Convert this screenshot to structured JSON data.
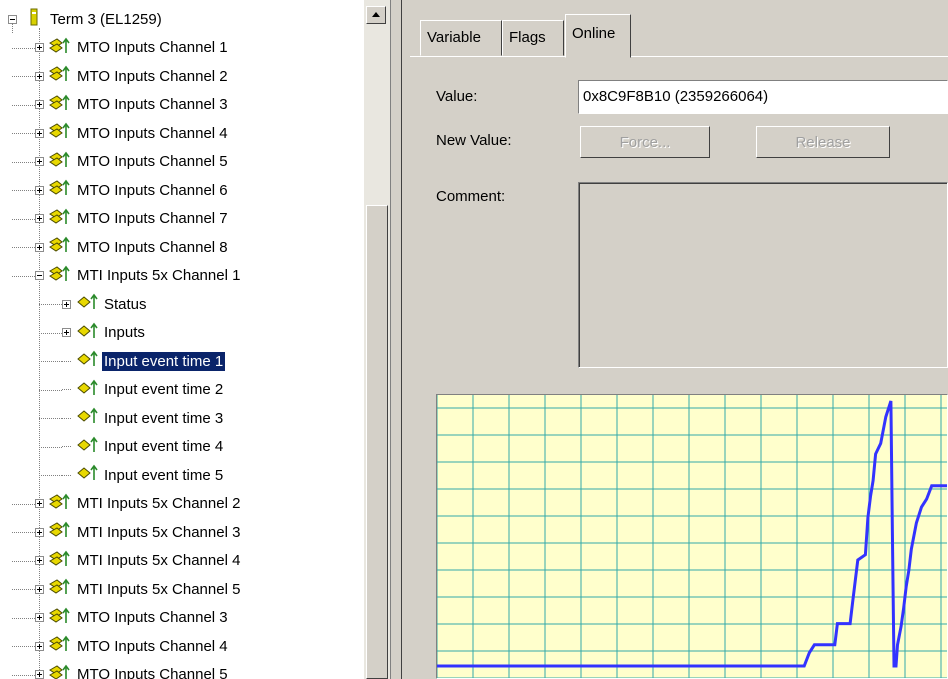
{
  "tree": {
    "root": {
      "label": "Term 3 (EL1259)",
      "icon": "terminal-icon"
    },
    "items": [
      {
        "label": "MTO Inputs Channel 1",
        "level": 1,
        "expander": "plus",
        "icon": "variable-group-icon"
      },
      {
        "label": "MTO Inputs Channel 2",
        "level": 1,
        "expander": "plus",
        "icon": "variable-group-icon"
      },
      {
        "label": "MTO Inputs Channel 3",
        "level": 1,
        "expander": "plus",
        "icon": "variable-group-icon"
      },
      {
        "label": "MTO Inputs Channel 4",
        "level": 1,
        "expander": "plus",
        "icon": "variable-group-icon"
      },
      {
        "label": "MTO Inputs Channel 5",
        "level": 1,
        "expander": "plus",
        "icon": "variable-group-icon"
      },
      {
        "label": "MTO Inputs Channel 6",
        "level": 1,
        "expander": "plus",
        "icon": "variable-group-icon"
      },
      {
        "label": "MTO Inputs Channel 7",
        "level": 1,
        "expander": "plus",
        "icon": "variable-group-icon"
      },
      {
        "label": "MTO Inputs Channel 8",
        "level": 1,
        "expander": "plus",
        "icon": "variable-group-icon"
      },
      {
        "label": "MTI Inputs 5x Channel 1",
        "level": 1,
        "expander": "minus",
        "icon": "variable-group-icon"
      },
      {
        "label": "Status",
        "level": 2,
        "expander": "plus",
        "icon": "input-variable-icon"
      },
      {
        "label": "Inputs",
        "level": 2,
        "expander": "plus",
        "icon": "input-variable-icon"
      },
      {
        "label": "Input event time 1",
        "level": 2,
        "expander": "none",
        "icon": "input-variable-icon",
        "selected": true
      },
      {
        "label": "Input event time 2",
        "level": 2,
        "expander": "none",
        "icon": "input-variable-icon"
      },
      {
        "label": "Input event time 3",
        "level": 2,
        "expander": "none",
        "icon": "input-variable-icon"
      },
      {
        "label": "Input event time 4",
        "level": 2,
        "expander": "none",
        "icon": "input-variable-icon"
      },
      {
        "label": "Input event time 5",
        "level": 2,
        "expander": "none",
        "icon": "input-variable-icon"
      },
      {
        "label": "MTI Inputs 5x Channel 2",
        "level": 1,
        "expander": "plus",
        "icon": "variable-group-icon"
      },
      {
        "label": "MTI Inputs 5x Channel 3",
        "level": 1,
        "expander": "plus",
        "icon": "variable-group-icon"
      },
      {
        "label": "MTI Inputs 5x Channel 4",
        "level": 1,
        "expander": "plus",
        "icon": "variable-group-icon"
      },
      {
        "label": "MTI Inputs 5x Channel 5",
        "level": 1,
        "expander": "plus",
        "icon": "variable-group-icon"
      },
      {
        "label": "MTO Inputs Channel 3",
        "level": 1,
        "expander": "plus",
        "icon": "variable-group-icon"
      },
      {
        "label": "MTO Inputs Channel 4",
        "level": 1,
        "expander": "plus",
        "icon": "variable-group-icon"
      },
      {
        "label": "MTO Inputs Channel 5",
        "level": 1,
        "expander": "plus",
        "icon": "variable-group-icon"
      }
    ]
  },
  "tabs": [
    {
      "label": "Variable",
      "active": false
    },
    {
      "label": "Flags",
      "active": false
    },
    {
      "label": "Online",
      "active": true
    }
  ],
  "online": {
    "value_label": "Value:",
    "value": "0x8C9F8B10 (2359266064)",
    "new_value_label": "New Value:",
    "force_button": "Force...",
    "release_button": "Release",
    "comment_label": "Comment:",
    "comment": ""
  },
  "colors": {
    "chart_background": "#ffffcc",
    "chart_grid": "#33aaaa",
    "chart_line": "#3333ff",
    "selection": "#0a246a",
    "panel": "#d4d0c8",
    "icon_yellow": "#e8d800",
    "icon_dark": "#4a4a00"
  },
  "chart_data": {
    "type": "line",
    "title": "",
    "xlabel": "",
    "ylabel": "",
    "grid": true,
    "xlim": [
      0,
      100
    ],
    "ylim": [
      0,
      100
    ],
    "series": [
      {
        "x": [
          0,
          72,
          73,
          74,
          78,
          78.5,
          81,
          81.5,
          82,
          82.5,
          84,
          84.5,
          85,
          85.5,
          86,
          87,
          88,
          89,
          89.3,
          89.6,
          90,
          90.3,
          91,
          91.5,
          92,
          92.5,
          93,
          94,
          95,
          96,
          97,
          98,
          100
        ],
        "y": [
          0,
          0,
          5,
          8,
          8,
          16,
          16,
          24,
          32,
          40,
          42,
          56,
          64,
          70,
          80,
          84,
          94,
          100,
          50,
          0,
          0,
          8,
          15,
          22,
          30,
          36,
          44,
          54,
          60,
          63,
          68,
          68,
          68
        ]
      }
    ]
  }
}
